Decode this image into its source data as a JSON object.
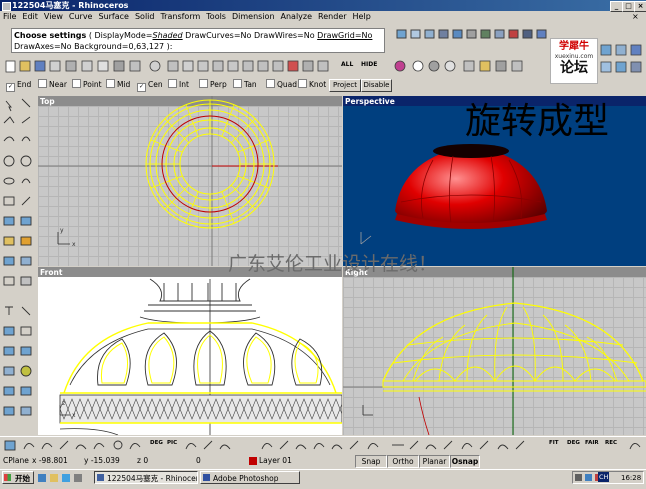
{
  "window": {
    "title": "122504马塞克 - Rhinoceros"
  },
  "menu": [
    "File",
    "Edit",
    "View",
    "Curve",
    "Surface",
    "Solid",
    "Transform",
    "Tools",
    "Dimension",
    "Analyze",
    "Render",
    "Help"
  ],
  "command": {
    "line1_bold": "Choose settings",
    "line1_rest": " ( DisplayMode=",
    "shaded": "Shaded",
    "drawcurves": " DrawCurves=No DrawWires=No ",
    "drawgrid": "DrawGrid=No",
    "line2": "DrawAxes=No Background=0,63,127 ):"
  },
  "toolbar_labels": {
    "all": "ALL",
    "hide": "HIDE"
  },
  "osnap": {
    "items": [
      {
        "label": "End",
        "checked": true
      },
      {
        "label": "Near",
        "checked": false
      },
      {
        "label": "Point",
        "checked": false
      },
      {
        "label": "Mid",
        "checked": false
      },
      {
        "label": "Cen",
        "checked": true
      },
      {
        "label": "Int",
        "checked": false
      },
      {
        "label": "Perp",
        "checked": false
      },
      {
        "label": "Tan",
        "checked": false
      },
      {
        "label": "Quad",
        "checked": false
      },
      {
        "label": "Knot",
        "checked": false
      }
    ],
    "project": "Project",
    "disable": "Disable"
  },
  "viewports": {
    "top": "Top",
    "perspective": "Perspective",
    "front": "Front",
    "right": "Right"
  },
  "overlay": {
    "title_cn": "旋转成型",
    "watermark_cn": "广东艾伦工业设计在线！",
    "logo_top": "学犀牛",
    "logo_url": "xuexinu.com",
    "logo_bottom": "论坛"
  },
  "bottom_toolbar_labels": {
    "deg": "DEG",
    "pic": "PIC",
    "fit": "FIT",
    "fair": "FAIR",
    "rec": "REC"
  },
  "status": {
    "cplane": "CPlane",
    "x": "x -98.801",
    "y": "y -15.039",
    "z": "z 0",
    "zval": "0",
    "layer": "Layer 01",
    "snap": "Snap",
    "ortho": "Ortho",
    "planar": "Planar",
    "osnap": "Osnap"
  },
  "taskbar": {
    "start": "开始",
    "task1": "122504马塞克 - Rhinoceros",
    "task2": "Adobe Photoshop",
    "ch": "CH",
    "time": "16:28"
  },
  "colors": {
    "accent_title": "#0a246a",
    "viewport_active": "#0a246a",
    "persp_bg": "#003f7f",
    "wire": "#ffff00",
    "object_red": "#d40000"
  }
}
